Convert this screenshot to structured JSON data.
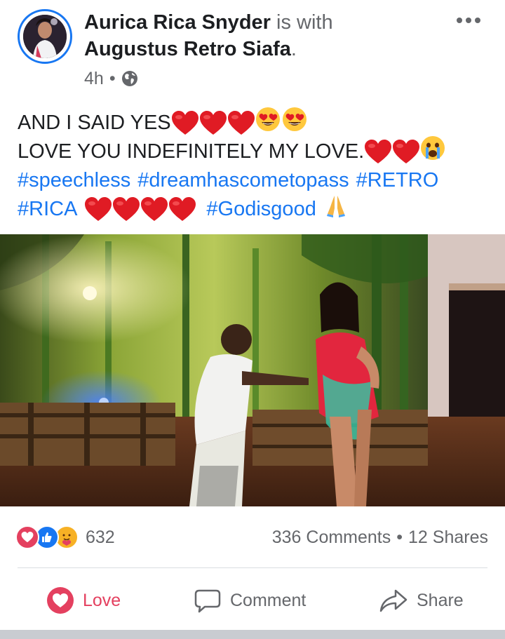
{
  "post": {
    "author": "Aurica Rica Snyder",
    "with_text": "is with",
    "tagged": "Augustus Retro Siafa",
    "tagged_suffix": ".",
    "time": "4h",
    "dot": "•",
    "audience_icon": "globe-icon",
    "more_icon": "more-options-icon"
  },
  "text": {
    "line1": "AND I SAID YES",
    "line2": "LOVE YOU INDEFINITELY MY LOVE.",
    "tags_line3": [
      "#speechless",
      "#dreamhascometopass",
      "#RETRO"
    ],
    "tag_rica": "#RICA",
    "tag_godisgood": "#Godisgood"
  },
  "engagement": {
    "reaction_icons": [
      "love-reaction-icon",
      "like-reaction-icon",
      "care-reaction-icon"
    ],
    "reaction_count": "632",
    "comments": "336 Comments",
    "sep": "•",
    "shares": "12 Shares"
  },
  "actions": {
    "love_label": "Love",
    "comment_label": "Comment",
    "share_label": "Share"
  },
  "colors": {
    "accent": "#1877f2",
    "love": "#e4405f",
    "muted": "#65676b"
  }
}
